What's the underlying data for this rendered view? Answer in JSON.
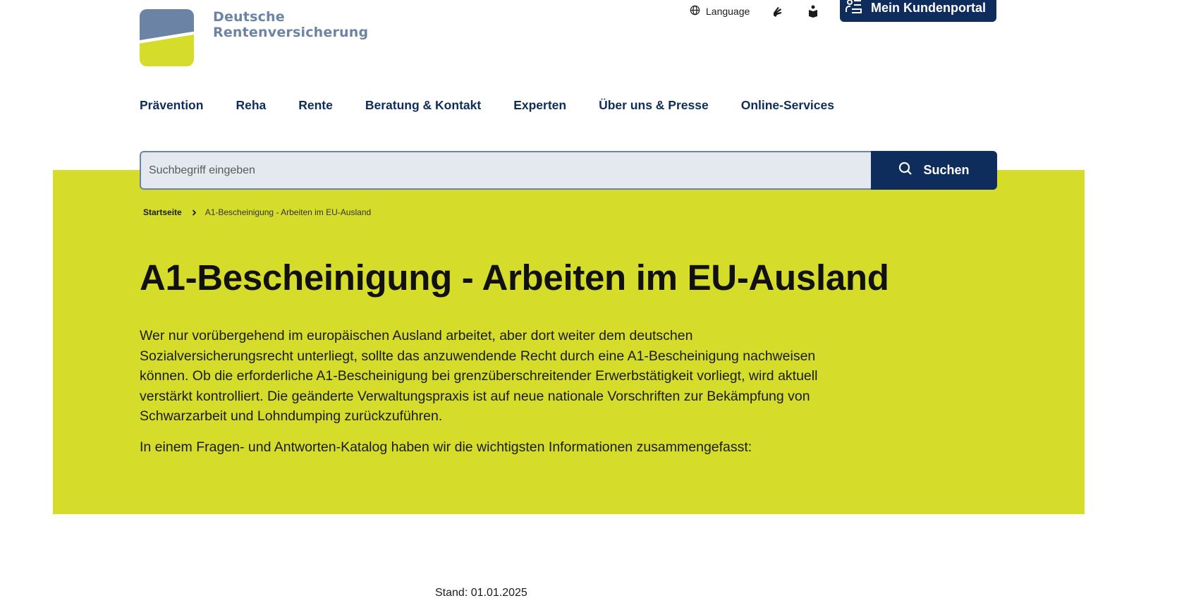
{
  "logo": {
    "line1": "Deutsche",
    "line2": "Rentenversicherung"
  },
  "utility": {
    "language_label": "Language",
    "icons": [
      "globe-icon",
      "sign-language-icon",
      "easy-language-icon"
    ],
    "portal_label": "Mein Kundenportal"
  },
  "nav": {
    "items": [
      {
        "label": "Prävention"
      },
      {
        "label": "Reha"
      },
      {
        "label": "Rente"
      },
      {
        "label": "Beratung & Kontakt"
      },
      {
        "label": "Experten"
      },
      {
        "label": "Über uns & Presse"
      },
      {
        "label": "Online-Services"
      }
    ]
  },
  "search": {
    "placeholder": "Suchbegriff eingeben",
    "button_label": "Suchen"
  },
  "breadcrumb": {
    "home": "Startseite",
    "current": "A1-Bescheinigung - Arbeiten im EU-Ausland"
  },
  "page": {
    "title": "A1-Bescheinigung - Arbeiten im EU-Ausland",
    "intro": "Wer nur vorübergehend im europäischen Ausland arbeitet, aber dort weiter dem deutschen Sozialversicherungsrecht unterliegt, sollte das anzuwendende Recht durch eine A1-Bescheinigung nachweisen können. Ob die erforderliche A1-Bescheinigung bei grenzüberschreitender Erwerbstätigkeit vorliegt, wird aktuell verstärkt kontrolliert. Die geänderte Verwaltungspraxis ist auf neue nationale Vorschriften zur Bekämpfung von Schwarzarbeit und Lohndumping zurückzuführen.",
    "intro2": "In einem Fragen- und Antworten-Katalog haben wir die wichtigsten Informationen zusammengefasst:",
    "stand": "Stand: 01.01.2025"
  },
  "colors": {
    "brand_navy": "#0f2d5c",
    "brand_blue": "#6b84a5",
    "brand_lime": "#d5dd2a"
  }
}
